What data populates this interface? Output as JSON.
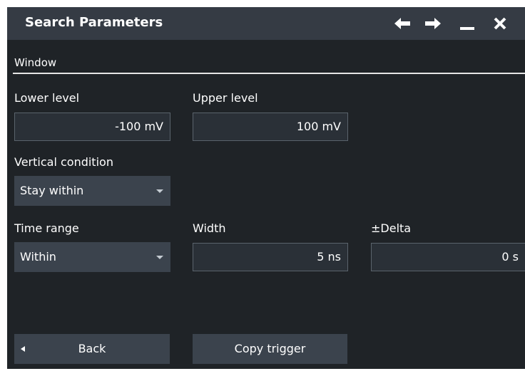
{
  "window": {
    "title": "Search Parameters",
    "icons": [
      "arrow-left-icon",
      "arrow-right-icon",
      "minimize-icon",
      "close-icon"
    ]
  },
  "section": {
    "label": "Window"
  },
  "fields": {
    "lower_level": {
      "label": "Lower level",
      "value": "-100 mV"
    },
    "upper_level": {
      "label": "Upper level",
      "value": "100 mV"
    },
    "vertical_condition": {
      "label": "Vertical condition",
      "value": "Stay within"
    },
    "time_range": {
      "label": "Time range",
      "value": "Within"
    },
    "width": {
      "label": "Width",
      "value": "5 ns"
    },
    "delta": {
      "label": "±Delta",
      "value": "0 s"
    }
  },
  "buttons": {
    "back": "Back",
    "copy_trigger": "Copy trigger"
  },
  "colors": {
    "background": "#1f2327",
    "titlebar": "#353b44",
    "control": "#3b434d",
    "input": "#2a3037",
    "input_border": "#5a636c",
    "text": "#ffffff"
  }
}
